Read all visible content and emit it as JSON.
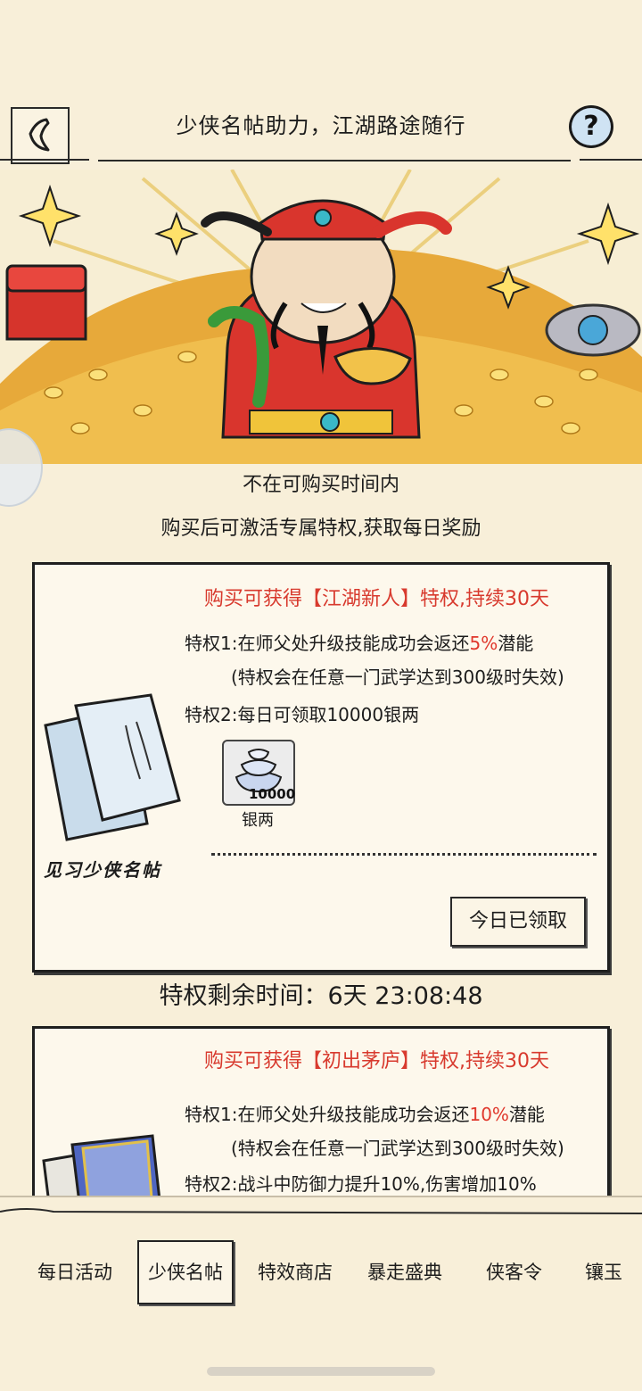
{
  "header": {
    "title": "少侠名帖助力，江湖路途随行",
    "help_label": "?"
  },
  "banner": {
    "status": "不在可购买时间内",
    "description": "购买后可激活专属特权,获取每日奖励"
  },
  "cards": [
    {
      "title": "购买可获得【江湖新人】特权,持续30天",
      "privilege1_prefix": "特权1:在师父处升级技能成功会返还",
      "privilege1_value": "5%",
      "privilege1_suffix": "潜能",
      "privilege1_note": "(特权会在任意一门武学达到300级时失效)",
      "privilege2": "特权2:每日可领取10000银两",
      "reward_amount": "10000",
      "reward_name": "银两",
      "card_name": "见习少侠名帖",
      "claim_label": "今日已领取"
    },
    {
      "title": "购买可获得【初出茅庐】特权,持续30天",
      "privilege1_prefix": "特权1:在师父处升级技能成功会返还",
      "privilege1_value": "10%",
      "privilege1_suffix": "潜能",
      "privilege1_note": "(特权会在任意一门武学达到300级时失效)",
      "privilege2": "特权2:战斗中防御力提升10%,伤害增加10%"
    }
  ],
  "remaining_time": "特权剩余时间：6天 23:08:48",
  "tabs": [
    {
      "label": "每日活动",
      "active": false
    },
    {
      "label": "少侠名帖",
      "active": true
    },
    {
      "label": "特效商店",
      "active": false
    },
    {
      "label": "暴走盛典",
      "active": false
    },
    {
      "label": "侠客令",
      "active": false
    },
    {
      "label": "镶玉",
      "active": false
    }
  ],
  "colors": {
    "background": "#f8efd9",
    "accent_red": "#d83a2e",
    "help_blue": "#cfe3f3"
  }
}
